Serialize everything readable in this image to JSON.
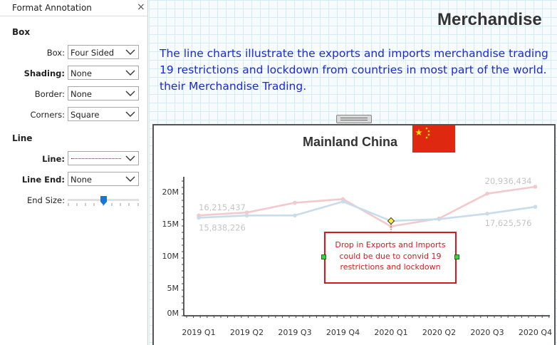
{
  "pane": {
    "title": "Format Annotation",
    "close_glyph": "×",
    "box_section": "Box",
    "box_rows": [
      {
        "label": "Box:",
        "value": "Four Sided"
      },
      {
        "label": "Shading:",
        "value": "None"
      },
      {
        "label": "Border:",
        "value": "None"
      },
      {
        "label": "Corners:",
        "value": "Square"
      }
    ],
    "line_section": "Line",
    "line_rows": [
      {
        "label": "Line:",
        "value": ""
      },
      {
        "label": "Line End:",
        "value": "None"
      }
    ],
    "end_size_label": "End Size:",
    "end_size_level": 0.5
  },
  "dashboard": {
    "title": "Merchandise",
    "description_lines": [
      "The line charts illustrate the exports and imports merchandise trading",
      "19 restrictions and lockdown from countries in most part of the world.",
      "their Merchandise Trading."
    ],
    "chart_title": "Mainland China",
    "flag": "china-flag",
    "annotation_lines": [
      "Drop in Exports and Imports",
      "could be due to convid 19",
      "restrictions and lockdown"
    ]
  },
  "colors": {
    "description": "#1c29d4",
    "exports_line": "#f2c9cd",
    "imports_line": "#c9dceb",
    "annotation": "#d41a1f",
    "flag_red": "#de2910",
    "flag_star": "#ffde00"
  },
  "chart_data": {
    "type": "line",
    "categories": [
      "2019 Q1",
      "2019 Q2",
      "2019 Q3",
      "2019 Q4",
      "2020 Q1",
      "2020 Q2",
      "2020 Q3",
      "2020 Q4"
    ],
    "y_ticks": [
      "0M",
      "5M",
      "10M",
      "15M",
      "20M"
    ],
    "ylim": [
      0,
      22500000
    ],
    "series": [
      {
        "values": [
          16215437,
          16700000,
          18300000,
          18900000,
          14400000,
          15700000,
          19800000,
          20936434
        ]
      },
      {
        "values": [
          15838226,
          16200000,
          16200000,
          18500000,
          15300000,
          15600000,
          16500000,
          17625576
        ]
      }
    ],
    "data_labels": [
      {
        "series": 0,
        "index": 0,
        "text": "16,215,437",
        "pos": "above"
      },
      {
        "series": 1,
        "index": 0,
        "text": "15,838,226",
        "pos": "below"
      },
      {
        "series": 0,
        "index": 7,
        "text": "20,936,434",
        "pos": "left-above"
      },
      {
        "series": 1,
        "index": 7,
        "text": "17,625,576",
        "pos": "left-below"
      }
    ],
    "annotation_target": {
      "series": 1,
      "index": 4
    },
    "grid": false,
    "xlabel": "",
    "ylabel": ""
  }
}
